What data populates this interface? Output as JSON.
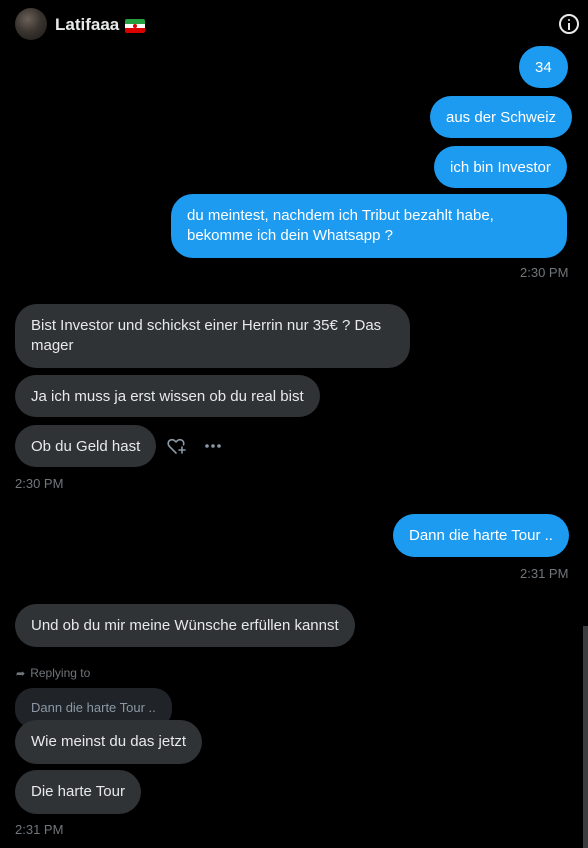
{
  "header": {
    "name": "Latifaaa",
    "flag_icon": "iran-flag-icon",
    "info_icon": "info-icon"
  },
  "messages": [
    {
      "id": "m1",
      "dir": "out",
      "text": "34"
    },
    {
      "id": "m2",
      "dir": "out",
      "text": "aus der Schweiz"
    },
    {
      "id": "m3",
      "dir": "out",
      "text": "ich bin Investor"
    },
    {
      "id": "m4",
      "dir": "out",
      "text": "du meintest, nachdem ich Tribut bezahlt habe, bekomme ich dein Whatsapp ?"
    },
    {
      "id": "m5",
      "dir": "in",
      "text": "Bist Investor und schickst einer Herrin nur 35€ ? Das mager"
    },
    {
      "id": "m6",
      "dir": "in",
      "text": "Ja ich muss ja erst wissen ob du real bist"
    },
    {
      "id": "m7",
      "dir": "in",
      "text": "Ob du Geld hast"
    },
    {
      "id": "m8",
      "dir": "out",
      "text": "Dann die harte Tour .."
    },
    {
      "id": "m9",
      "dir": "in",
      "text": "Und ob du mir meine Wünsche erfüllen kannst"
    },
    {
      "id": "m10",
      "dir": "in",
      "text": "Wie meinst du das jetzt"
    },
    {
      "id": "m11",
      "dir": "in",
      "text": "Die harte Tour"
    }
  ],
  "timestamps": {
    "t1": "2:30 PM",
    "t2": "2:30 PM",
    "t3": "2:31 PM",
    "t4": "2:31 PM"
  },
  "reply": {
    "label": "Replying to",
    "quoted_text": "Dann die harte Tour .."
  },
  "message_actions": {
    "react_icon": "heart-plus-icon",
    "more_icon": "more-horizontal-icon"
  },
  "colors": {
    "outgoing_bubble": "#1d9bf0",
    "incoming_bubble": "#2f3336",
    "background": "#000000",
    "timestamp": "#71767b"
  }
}
